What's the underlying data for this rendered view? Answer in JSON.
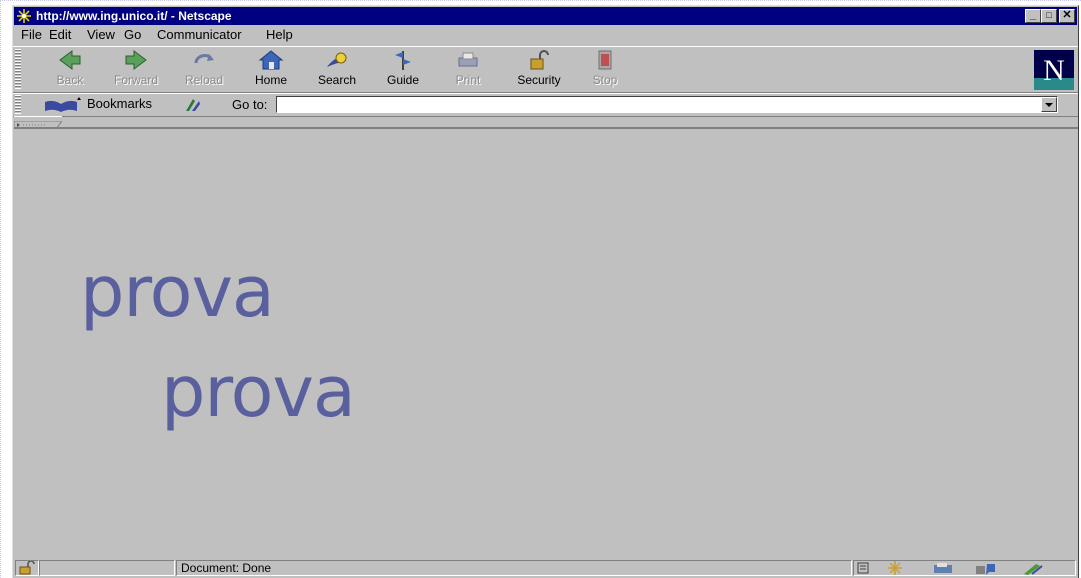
{
  "window": {
    "title": "http://www.ing.unico.it/ - Netscape",
    "min_label": "_",
    "max_label": "□",
    "close_label": "✕"
  },
  "menubar": {
    "items": [
      {
        "label": "File"
      },
      {
        "label": "Edit"
      },
      {
        "label": "View"
      },
      {
        "label": "Go"
      },
      {
        "label": "Communicator"
      },
      {
        "label": "Help"
      }
    ]
  },
  "toolbar": {
    "buttons": [
      {
        "label": "Back",
        "icon": "back-arrow-icon",
        "enabled": false
      },
      {
        "label": "Forward",
        "icon": "forward-arrow-icon",
        "enabled": false
      },
      {
        "label": "Reload",
        "icon": "reload-icon",
        "enabled": false
      },
      {
        "label": "Home",
        "icon": "home-icon",
        "enabled": true
      },
      {
        "label": "Search",
        "icon": "search-icon",
        "enabled": true
      },
      {
        "label": "Guide",
        "icon": "guide-icon",
        "enabled": true
      },
      {
        "label": "Print",
        "icon": "printer-icon",
        "enabled": false
      },
      {
        "label": "Security",
        "icon": "padlock-icon",
        "enabled": true
      },
      {
        "label": "Stop",
        "icon": "stop-icon",
        "enabled": false
      }
    ],
    "brand_letter": "N"
  },
  "location": {
    "bookmarks_label": "Bookmarks",
    "goto_label": "Go to:",
    "url_value": ""
  },
  "content": {
    "line1": "prova",
    "line2": "prova",
    "text_color": "#5a5f9e"
  },
  "statusbar": {
    "status_text": "Document: Done"
  },
  "colors": {
    "titlebar": "#000080",
    "chrome": "#c0c0c0"
  }
}
